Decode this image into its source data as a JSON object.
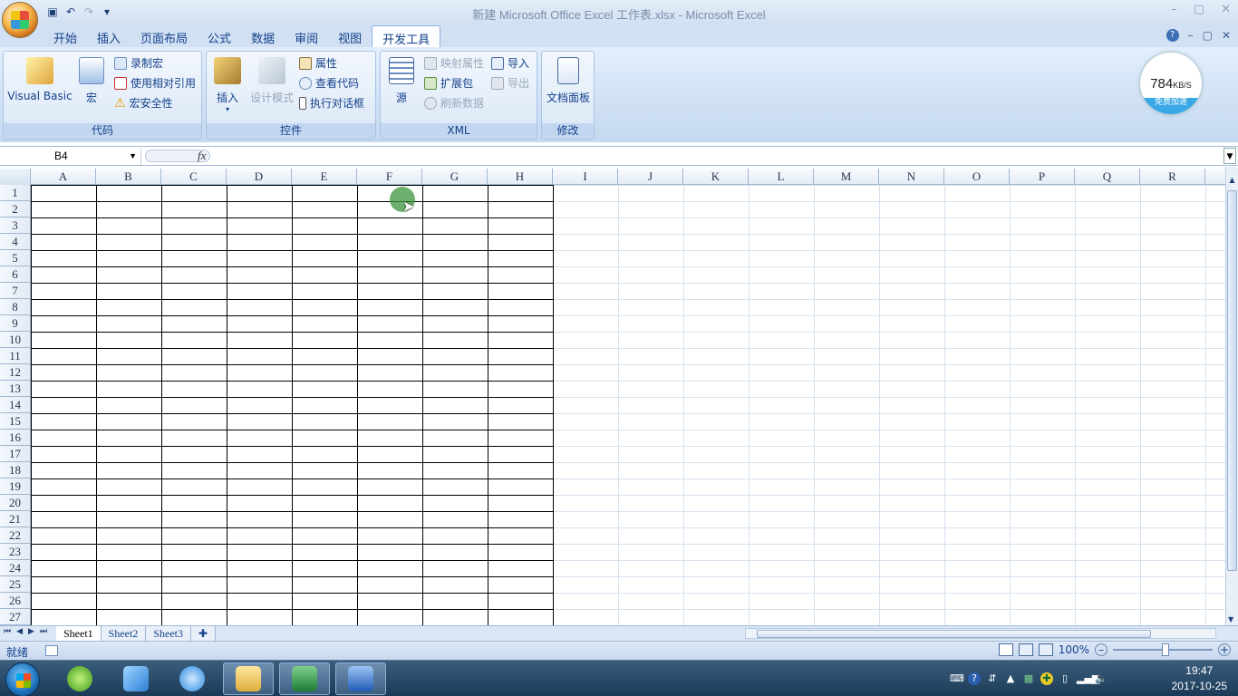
{
  "window": {
    "title": "新建 Microsoft Office Excel 工作表.xlsx - Microsoft Excel",
    "min": "–",
    "max": "▢",
    "close": "✕"
  },
  "qat": {
    "save": "save-icon",
    "undo": "↶",
    "redo": "↷",
    "more": "▾"
  },
  "tabs": [
    {
      "label": "开始"
    },
    {
      "label": "插入"
    },
    {
      "label": "页面布局"
    },
    {
      "label": "公式"
    },
    {
      "label": "数据"
    },
    {
      "label": "审阅"
    },
    {
      "label": "视图"
    },
    {
      "label": "开发工具",
      "active": true
    }
  ],
  "tabbar_right": {
    "help": "?",
    "min": "–",
    "restore": "▢",
    "close": "✕"
  },
  "ribbon": {
    "code": {
      "label": "代码",
      "visual_basic": "Visual Basic",
      "macros": "宏",
      "record_macro": "录制宏",
      "relative_ref": "使用相对引用",
      "macro_security": "宏安全性"
    },
    "controls": {
      "label": "控件",
      "insert": "插入",
      "design_mode": "设计模式",
      "properties": "属性",
      "view_code": "查看代码",
      "run_dialog": "执行对话框"
    },
    "xml": {
      "label": "XML",
      "source": "源",
      "map_properties": "映射属性",
      "expansion_packs": "扩展包",
      "refresh_data": "刷新数据",
      "import": "导入",
      "export": "导出"
    },
    "modify": {
      "label": "修改",
      "document_panel": "文档面板"
    }
  },
  "speed_widget": {
    "value": "784",
    "unit": "KB/S",
    "caption": "免费加速"
  },
  "formula_bar": {
    "name_box": "B4",
    "fx": "fx",
    "formula": ""
  },
  "grid": {
    "columns": [
      "A",
      "B",
      "C",
      "D",
      "E",
      "F",
      "G",
      "H",
      "I",
      "J",
      "K",
      "L",
      "M",
      "N",
      "O",
      "P",
      "Q",
      "R"
    ],
    "rows": [
      "1",
      "2",
      "3",
      "4",
      "5",
      "6",
      "7",
      "8",
      "9",
      "10",
      "11",
      "12",
      "13",
      "14",
      "15",
      "16",
      "17",
      "18",
      "19",
      "20",
      "21",
      "22",
      "23",
      "24",
      "25",
      "26",
      "27"
    ],
    "bordered_range": "A1:H27"
  },
  "sheets": [
    {
      "label": "Sheet1",
      "active": true
    },
    {
      "label": "Sheet2"
    },
    {
      "label": "Sheet3"
    }
  ],
  "status": {
    "ready": "就绪",
    "zoom": "100%",
    "zoom_out": "–",
    "zoom_in": "+"
  },
  "taskbar": {
    "apps": [
      "browser-icon",
      "bird-icon",
      "cloud-icon",
      "folder-icon",
      "excel-icon",
      "word-icon"
    ],
    "time": "19:47",
    "date": "2017-10-25"
  },
  "colors": {
    "ribbon_text": "#15428b",
    "active_tab_border": "#8db2e3",
    "grid_line": "#d6e1ef",
    "taskbar": "#1b3a57"
  }
}
